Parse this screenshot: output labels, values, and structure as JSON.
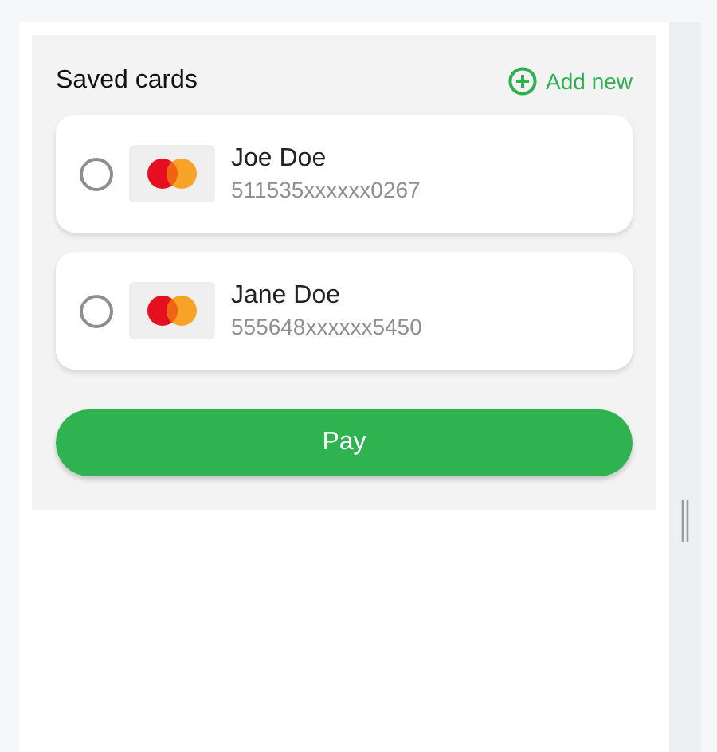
{
  "title": "Saved cards",
  "add_button": {
    "label": "Add new"
  },
  "cards": [
    {
      "name": "Joe Doe",
      "number": "511535xxxxxx0267",
      "selected": false
    },
    {
      "name": "Jane Doe",
      "number": "555648xxxxxx5450",
      "selected": false
    }
  ],
  "pay_button": {
    "label": "Pay"
  }
}
